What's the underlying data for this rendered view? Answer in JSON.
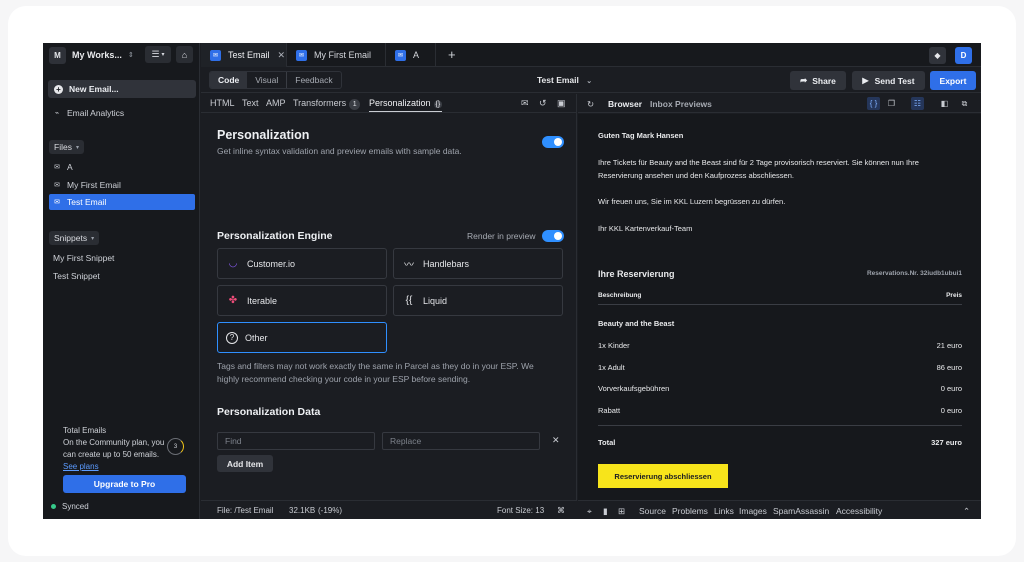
{
  "workspace": {
    "initial": "M",
    "name": "My Works..."
  },
  "sidebar": {
    "new_email": "New Email...",
    "analytics": "Email Analytics",
    "files_label": "Files",
    "files": [
      "A",
      "My First Email",
      "Test Email"
    ],
    "snippets_label": "Snippets",
    "snippets": [
      "My First Snippet",
      "Test Snippet"
    ],
    "usage_title": "Total Emails",
    "usage_text": "On the Community plan, you can create up to 50 emails.",
    "usage_link": "See plans",
    "usage_count": "3",
    "upgrade": "Upgrade to Pro",
    "synced": "Synced"
  },
  "tabs": [
    {
      "label": "Test Email"
    },
    {
      "label": "My First Email"
    },
    {
      "label": "A"
    }
  ],
  "user_initial": "D",
  "toolbar": {
    "modes": [
      "Code",
      "Visual",
      "Feedback"
    ],
    "title": "Test Email",
    "share": "Share",
    "send_test": "Send Test",
    "export": "Export"
  },
  "editor": {
    "subtabs": [
      "HTML",
      "Text",
      "AMP",
      "Transformers",
      "Personalization"
    ],
    "transformers_count": "1",
    "title": "Personalization",
    "subtitle": "Get inline syntax validation and preview emails with sample data.",
    "engine_heading": "Personalization Engine",
    "render_label": "Render in preview",
    "engines": [
      "Customer.io",
      "Handlebars",
      "Iterable",
      "Liquid",
      "Other"
    ],
    "warning": "Tags and filters may not work exactly the same in Parcel as they do in your ESP. We highly recommend checking your code in your ESP before sending.",
    "data_heading": "Personalization Data",
    "find_placeholder": "Find",
    "replace_placeholder": "Replace",
    "add_item": "Add Item"
  },
  "status_left": {
    "file": "File: /Test Email",
    "size": "32.1KB",
    "delta": "(-19%)",
    "font_size": "Font Size: 13"
  },
  "preview": {
    "tabs": [
      "Browser",
      "Inbox Previews"
    ],
    "greeting": "Guten Tag Mark Hansen",
    "para1_line1": "Ihre Tickets für Beauty and the Beast sind für 2 Tage provisorisch reserviert. Sie können nun Ihre",
    "para1_line2": "Reservierung ansehen und den Kaufprozess abschliessen.",
    "para2": "Wir freuen uns, Sie im KKL Luzern begrüssen zu dürfen.",
    "sign": "Ihr KKL Kartenverkauf-Team",
    "res_title": "Ihre Reservierung",
    "res_nr": "Reservations.Nr. 32iudb1ubui1",
    "col_desc": "Beschreibung",
    "col_price": "Preis",
    "show": "Beauty and the Beast",
    "rows": [
      {
        "desc": "1x Kinder",
        "price": "21 euro"
      },
      {
        "desc": "1x Adult",
        "price": "86 euro"
      },
      {
        "desc": "Vorverkaufsgebühren",
        "price": "0 euro"
      },
      {
        "desc": "Rabatt",
        "price": "0 euro"
      }
    ],
    "total_label": "Total",
    "total_value": "327 euro",
    "cta": "Reservierung abschliessen"
  },
  "status_right": [
    "Source",
    "Problems",
    "Links",
    "Images",
    "SpamAssassin",
    "Accessibility"
  ]
}
